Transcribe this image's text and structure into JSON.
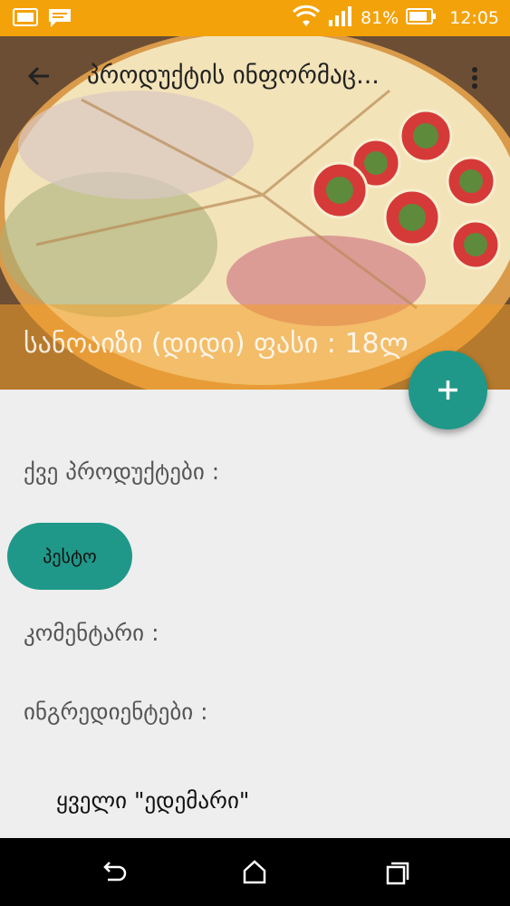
{
  "status_bar": {
    "battery_percent": "81%",
    "time": "12:05",
    "icons": [
      "gallery-notification-icon",
      "message-notification-icon",
      "wifi-icon",
      "signal-icon",
      "battery-icon"
    ]
  },
  "toolbar": {
    "title": "პროდუქტის ინფორმაც...",
    "icons": [
      "back-arrow-icon",
      "more-vert-icon"
    ]
  },
  "hero": {
    "price_text": "სანოაიზი (დიდი) ფასი : 18ლ",
    "overlay_color": "#f29e28"
  },
  "fab": {
    "icon": "plus-icon",
    "color": "#1f9889"
  },
  "sub_products": {
    "label": "ქვე პროდუქტები :",
    "chips": [
      {
        "label": "პესტო"
      }
    ]
  },
  "comment": {
    "label": "კომენტარი :"
  },
  "ingredients": {
    "label": "ინგრედიენტები :",
    "items": [
      "ყველი \"ედემარი\""
    ]
  },
  "nav_bar": {
    "icons": [
      "back-icon",
      "home-icon",
      "recents-icon"
    ]
  },
  "colors": {
    "status_bar": "#f4a20a",
    "accent": "#1f9889",
    "background": "#eeeeee"
  }
}
